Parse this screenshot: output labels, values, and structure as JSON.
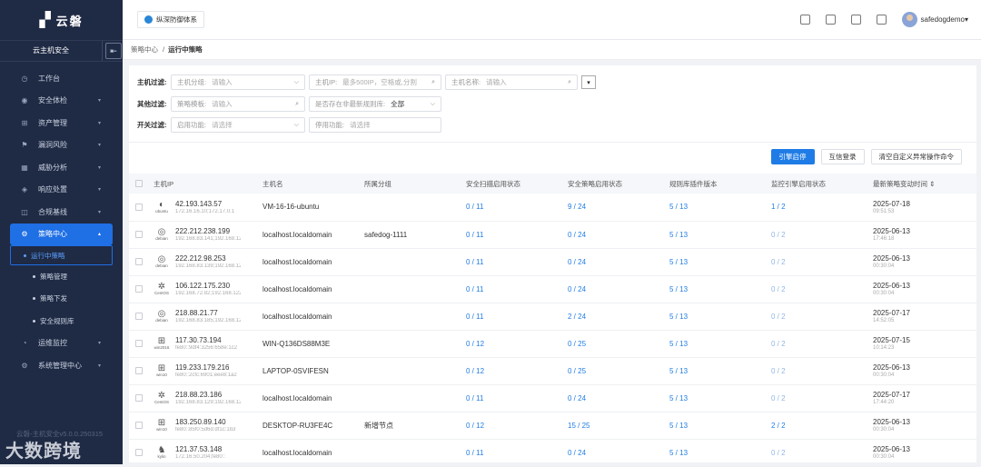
{
  "sidebar": {
    "logo": "云磐",
    "product": "云主机安全",
    "collapse_glyph": "⇤",
    "menu": [
      {
        "label": "工作台",
        "icon": "◷",
        "arrow": ""
      },
      {
        "label": "安全体检",
        "icon": "◉",
        "arrow": "▾"
      },
      {
        "label": "资产管理",
        "icon": "⊞",
        "arrow": "▾"
      },
      {
        "label": "漏洞风险",
        "icon": "⚑",
        "arrow": "▾"
      },
      {
        "label": "威胁分析",
        "icon": "▦",
        "arrow": "▾"
      },
      {
        "label": "响应处置",
        "icon": "◈",
        "arrow": "▾"
      },
      {
        "label": "合规基线",
        "icon": "◫",
        "arrow": "▾"
      }
    ],
    "active": {
      "label": "策略中心",
      "icon": "⚙",
      "arrow": "▴"
    },
    "subs": [
      "运行中策略",
      "策略管理",
      "策略下发",
      "安全规则库"
    ],
    "menu2": [
      {
        "label": "运维监控",
        "icon": "◔",
        "arrow": "▾"
      },
      {
        "label": "系统管理中心",
        "icon": "⚙",
        "arrow": "▾"
      }
    ],
    "version": "云磐-主机安全v5.0.0.250315",
    "watermark": "大数跨境"
  },
  "topbar": {
    "brand": "纵深防御体系",
    "user": "safedogdemo",
    "caret": "▾"
  },
  "breadcrumb": {
    "root": "策略中心",
    "sep": "/",
    "current": "运行中策略"
  },
  "filters": {
    "row1": {
      "label": "主机过滤:",
      "group_key": "主机分组:",
      "group_ph": "请输入",
      "ip_key": "主机IP:",
      "ip_ph": "最多500IP，空格或,分割",
      "name_key": "主机名称:",
      "name_ph": "请输入"
    },
    "row2": {
      "label": "其他过滤:",
      "tpl_key": "策略模板:",
      "tpl_ph": "请输入",
      "lib_key": "是否存在非最新规则库:",
      "lib_val": "全部"
    },
    "row3": {
      "label": "开关过滤:",
      "on_key": "启用功能:",
      "on_ph": "请选择",
      "off_key": "停用功能:",
      "off_ph": "请选择"
    },
    "chevron": "⌵",
    "search": "⌕",
    "toggle": "▾"
  },
  "actions": {
    "engine": "引擎启停",
    "trust": "互信登录",
    "clear": "清空自定义异常操作命令"
  },
  "table": {
    "headers": [
      "主机IP",
      "主机名",
      "所属分组",
      "安全扫描启用状态",
      "安全策略启用状态",
      "规则库插件版本",
      "监控引擎启用状态",
      "最新策略变动时间 ⇕"
    ],
    "rows": [
      {
        "os": "ubuntu",
        "g": "◐",
        "ip": "42.193.143.57",
        "lan": "172.16.16.10;172.17.0.1",
        "host": "VM-16-16-ubuntu",
        "group": "",
        "scan": "0 / 11",
        "pol": "9 / 24",
        "lib": "5 / 13",
        "mon": "1 / 2",
        "date": "2025-07-18",
        "time": "09:51:53"
      },
      {
        "os": "debian",
        "g": "◎",
        "ip": "222.212.238.199",
        "lan": "192.168.83.141;192.168.122.1",
        "host": "localhost.localdomain",
        "group": "safedog-1111",
        "scan": "0 / 11",
        "pol": "0 / 24",
        "lib": "5 / 13",
        "mon": "0 / 2",
        "date": "2025-06-13",
        "time": "17:46:18"
      },
      {
        "os": "debian",
        "g": "◎",
        "ip": "222.212.98.253",
        "lan": "192.168.83.139;192.168.122.1",
        "host": "localhost.localdomain",
        "group": "",
        "scan": "0 / 11",
        "pol": "0 / 24",
        "lib": "5 / 13",
        "mon": "0 / 2",
        "date": "2025-06-13",
        "time": "00:30:04"
      },
      {
        "os": "CentOS",
        "g": "✲",
        "ip": "106.122.175.230",
        "lan": "192.168.72.82;192.168.122.1",
        "host": "localhost.localdomain",
        "group": "",
        "scan": "0 / 11",
        "pol": "0 / 24",
        "lib": "5 / 13",
        "mon": "0 / 2",
        "date": "2025-06-13",
        "time": "00:30:04"
      },
      {
        "os": "debian",
        "g": "◎",
        "ip": "218.88.21.77",
        "lan": "192.168.83.185;192.168.122.1",
        "host": "localhost.localdomain",
        "group": "",
        "scan": "0 / 11",
        "pol": "2 / 24",
        "lib": "5 / 13",
        "mon": "0 / 2",
        "date": "2025-07-17",
        "time": "14:52:05"
      },
      {
        "os": "win2016",
        "g": "⊞",
        "ip": "117.30.73.194",
        "lan": "fe80::9df4:3256:658e:1c2",
        "host": "WIN-Q136DS88M3E",
        "group": "",
        "scan": "0 / 12",
        "pol": "0 / 25",
        "lib": "5 / 13",
        "mon": "0 / 2",
        "date": "2025-07-15",
        "time": "10:14:23"
      },
      {
        "os": "win10",
        "g": "⊞",
        "ip": "119.233.179.216",
        "lan": "fe80::2cfc:6901:eee8:1a2",
        "host": "LAPTOP-0SVIFESN",
        "group": "",
        "scan": "0 / 12",
        "pol": "0 / 25",
        "lib": "5 / 13",
        "mon": "0 / 2",
        "date": "2025-06-13",
        "time": "00:30:04"
      },
      {
        "os": "CentOS",
        "g": "✲",
        "ip": "218.88.23.186",
        "lan": "192.168.83.129;192.168.122.1",
        "host": "localhost.localdomain",
        "group": "",
        "scan": "0 / 11",
        "pol": "0 / 24",
        "lib": "5 / 13",
        "mon": "0 / 2",
        "date": "2025-07-17",
        "time": "17:44:20"
      },
      {
        "os": "win10",
        "g": "⊞",
        "ip": "183.250.89.140",
        "lan": "fe80::85f0:5d6d:df1c:1b3",
        "host": "DESKTOP-RU3FE4C",
        "group": "新增节点",
        "scan": "0 / 12",
        "pol": "15 / 25",
        "lib": "5 / 13",
        "mon": "2 / 2",
        "date": "2025-06-13",
        "time": "00:30:04"
      },
      {
        "os": "kylin",
        "g": "♞",
        "ip": "121.37.53.148",
        "lan": "172.16.50.204;fe80::",
        "host": "localhost.localdomain",
        "group": "",
        "scan": "0 / 11",
        "pol": "0 / 24",
        "lib": "5 / 13",
        "mon": "0 / 2",
        "date": "2025-06-13",
        "time": "00:30:04"
      }
    ]
  }
}
